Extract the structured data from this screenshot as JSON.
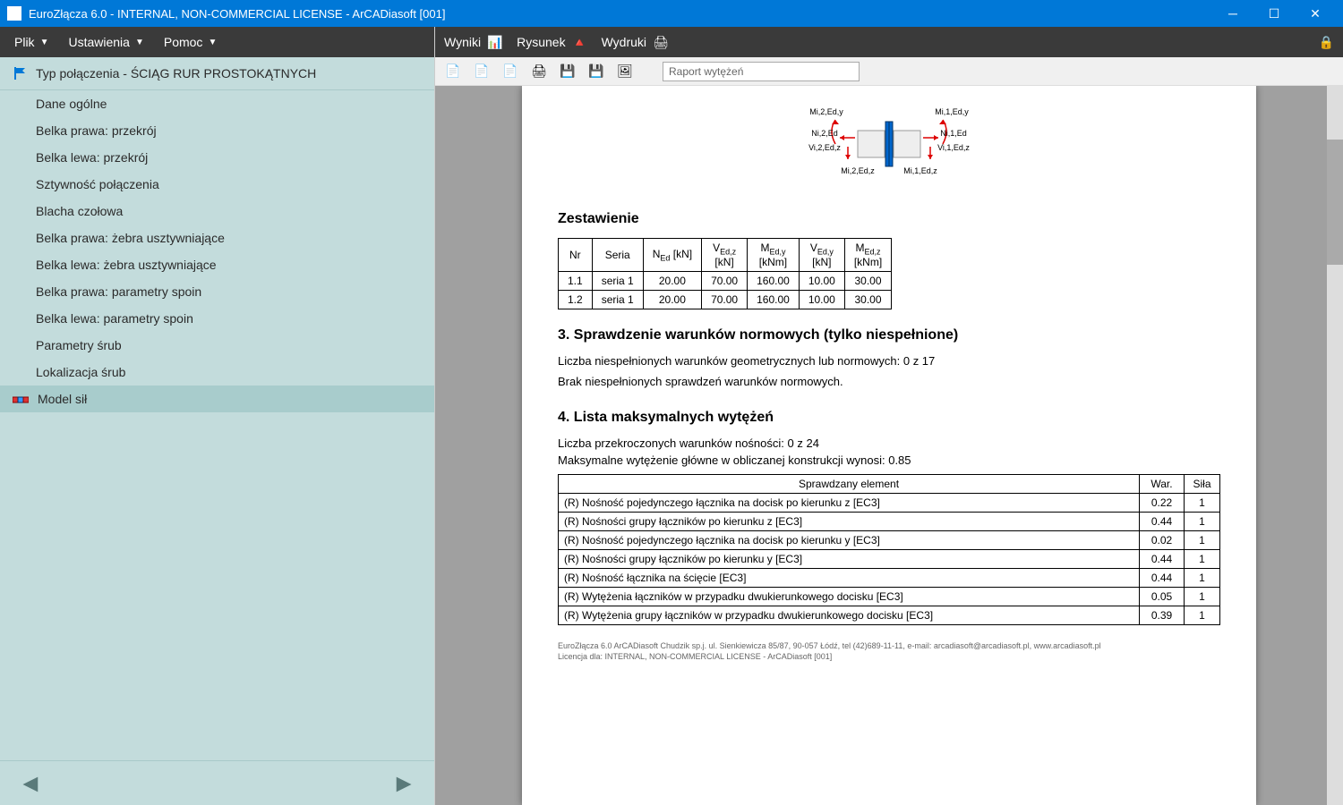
{
  "window": {
    "title": "EuroZłącza 6.0 - INTERNAL, NON-COMMERCIAL LICENSE - ArCADiasoft [001]"
  },
  "side_menu": {
    "plik": "Plik",
    "ustawienia": "Ustawienia",
    "pomoc": "Pomoc"
  },
  "tree": {
    "header": "Typ połączenia - ŚCIĄG RUR PROSTOKĄTNYCH",
    "items": [
      "Dane ogólne",
      "Belka prawa: przekrój",
      "Belka lewa: przekrój",
      "Sztywność połączenia",
      "Blacha czołowa",
      "Belka prawa: żebra usztywniające",
      "Belka lewa: żebra usztywniające",
      "Belka prawa: parametry spoin",
      "Belka lewa: parametry spoin",
      "Parametry śrub",
      "Lokalizacja śrub"
    ],
    "selected": "Model sił"
  },
  "main_menu": {
    "wyniki": "Wyniki",
    "rysunek": "Rysunek",
    "wydruki": "Wydruki"
  },
  "search": {
    "placeholder": "Raport wytężeń"
  },
  "diagram_labels": {
    "l_top": "Mi,2,Ed,y",
    "r_top": "Mi,1,Ed,y",
    "l_mid": "Ni,2,Ed",
    "r_mid": "Ni,1,Ed",
    "l_v": "Vi,2,Ed,z",
    "r_v": "Vi,1,Ed,z",
    "l_bot": "Mi,2,Ed,z",
    "r_bot": "Mi,1,Ed,z"
  },
  "zest": {
    "title": "Zestawienie"
  },
  "zest_head": {
    "nr": "Nr",
    "seria": "Seria",
    "ned": "NEd [kN]",
    "vedz": "VEd,z [kN]",
    "medy": "MEd,y [kNm]",
    "vedy": "VEd,y [kN]",
    "medz": "MEd,z [kNm]"
  },
  "zest_rows": [
    {
      "nr": "1.1",
      "seria": "seria 1",
      "ned": "20.00",
      "vedz": "70.00",
      "medy": "160.00",
      "vedy": "10.00",
      "medz": "30.00"
    },
    {
      "nr": "1.2",
      "seria": "seria 1",
      "ned": "20.00",
      "vedz": "70.00",
      "medy": "160.00",
      "vedy": "10.00",
      "medz": "30.00"
    }
  ],
  "sec3": {
    "title": "3. Sprawdzenie warunków normowych (tylko niespełnione)",
    "line1": "Liczba niespełnionych warunków geometrycznych lub normowych: 0 z 17",
    "line2": "Brak niespełnionych sprawdzeń warunków normowych."
  },
  "sec4": {
    "title": "4. Lista maksymalnych wytężeń",
    "line1": "Liczba przekroczonych warunków nośności: 0 z 24",
    "line2": "Maksymalne wytężenie główne w obliczanej konstrukcji wynosi: 0.85"
  },
  "t2_head": {
    "el": "Sprawdzany element",
    "war": "War.",
    "sila": "Siła"
  },
  "t2_rows": [
    {
      "el": "(R) Nośność pojedynczego łącznika na docisk po kierunku z [EC3]",
      "war": "0.22",
      "sila": "1"
    },
    {
      "el": "(R) Nośności grupy łączników po kierunku z [EC3]",
      "war": "0.44",
      "sila": "1"
    },
    {
      "el": "(R) Nośność pojedynczego łącznika na docisk po kierunku y [EC3]",
      "war": "0.02",
      "sila": "1"
    },
    {
      "el": "(R) Nośności grupy łączników po kierunku y [EC3]",
      "war": "0.44",
      "sila": "1"
    },
    {
      "el": "(R) Nośność łącznika na ścięcie [EC3]",
      "war": "0.44",
      "sila": "1"
    },
    {
      "el": "(R) Wytężenia łączników w przypadku dwukierunkowego docisku [EC3]",
      "war": "0.05",
      "sila": "1"
    },
    {
      "el": "(R) Wytężenia grupy łączników w przypadku dwukierunkowego docisku [EC3]",
      "war": "0.39",
      "sila": "1"
    }
  ],
  "footer": {
    "line1": "EuroZłącza 6.0 ArCADiasoft Chudzik sp.j. ul. Sienkiewicza 85/87, 90-057 Łódź, tel (42)689-11-11, e-mail: arcadiasoft@arcadiasoft.pl, www.arcadiasoft.pl",
    "line2": "Licencja dla: INTERNAL, NON-COMMERCIAL LICENSE - ArCADiasoft [001]"
  }
}
